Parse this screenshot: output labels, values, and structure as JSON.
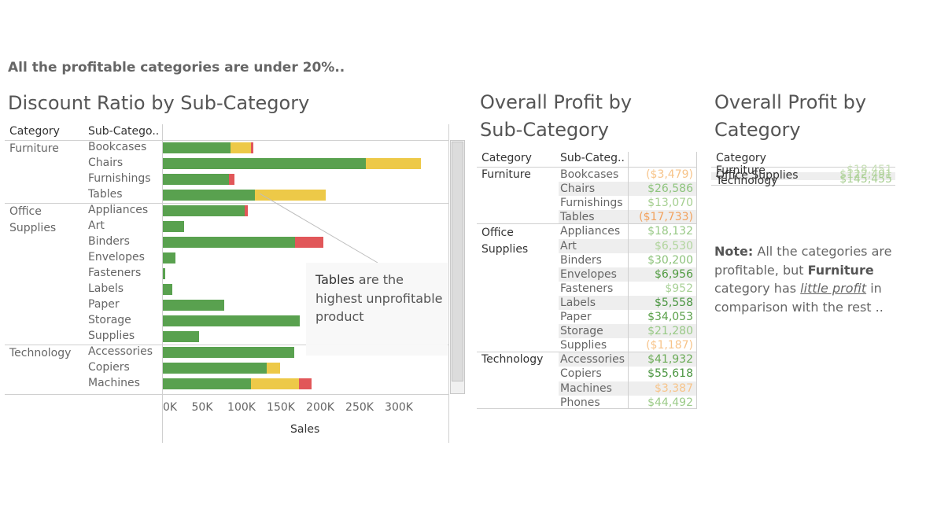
{
  "headline": "All the profitable categories are under 20%..",
  "discount_panel": {
    "title": "Discount Ratio by Sub-Category",
    "col_category": "Category",
    "col_subcategory": "Sub-Catego..",
    "xaxis_title": "Sales",
    "callout": {
      "bold": "Tables",
      "rest": " are the highest unprofitable product"
    }
  },
  "profit_sub_panel": {
    "title_line1": "Overall Profit by",
    "title_line2": "Sub-Category",
    "col_category": "Category",
    "col_subcategory": "Sub-Categ..",
    "categories": [
      "Furniture",
      "Office Supplies",
      "Technology"
    ],
    "rows": [
      {
        "sub": "Bookcases",
        "profit": "($3,479)",
        "color": "#f7c48a"
      },
      {
        "sub": "Chairs",
        "profit": "$26,586",
        "color": "#8fc47e"
      },
      {
        "sub": "Furnishings",
        "profit": "$13,070",
        "color": "#a5cf90"
      },
      {
        "sub": "Tables",
        "profit": "($17,733)",
        "color": "#f2a25e"
      },
      {
        "sub": "Appliances",
        "profit": "$18,132",
        "color": "#98c986"
      },
      {
        "sub": "Art",
        "profit": "$6,530",
        "color": "#b0d49c"
      },
      {
        "sub": "Binders",
        "profit": "$30,200",
        "color": "#8cc27a"
      },
      {
        "sub": "Envelopes",
        "profit": "$6,956",
        "color": "#4f9a3f"
      },
      {
        "sub": "Fasteners",
        "profit": "$952",
        "color": "#a9d197"
      },
      {
        "sub": "Labels",
        "profit": "$5,558",
        "color": "#4a9540"
      },
      {
        "sub": "Paper",
        "profit": "$34,053",
        "color": "#5aa049"
      },
      {
        "sub": "Storage",
        "profit": "$21,280",
        "color": "#98c986"
      },
      {
        "sub": "Supplies",
        "profit": "($1,187)",
        "color": "#f7c48a"
      },
      {
        "sub": "Accessories",
        "profit": "$41,932",
        "color": "#6aab56"
      },
      {
        "sub": "Copiers",
        "profit": "$55,618",
        "color": "#4a9540"
      },
      {
        "sub": "Machines",
        "profit": "$3,387",
        "color": "#f7c48a"
      },
      {
        "sub": "Phones",
        "profit": "$44,492",
        "color": "#9ccb89"
      }
    ]
  },
  "profit_cat_panel": {
    "title_line1": "Overall Profit by",
    "title_line2": "Category",
    "col_category": "Category",
    "overlap_labels": [
      "Furniture",
      "Office Supplies",
      "Technology"
    ],
    "overlap_values": [
      "$18,451",
      "$122,491",
      "$145,455"
    ]
  },
  "note": {
    "label": "Note:",
    "text1": " All the categories are profitable, but ",
    "bold": "Furniture",
    "text2": " category has ",
    "underlined": "little profit",
    "text3": " in comparison with the rest .."
  },
  "chart_data": {
    "type": "bar",
    "orientation": "horizontal",
    "stacked": true,
    "title": "Discount Ratio by Sub-Category",
    "xlabel": "Sales",
    "xlim": [
      0,
      345000
    ],
    "xticks": [
      0,
      50000,
      100000,
      150000,
      200000,
      250000,
      300000
    ],
    "xtick_labels": [
      "0K",
      "50K",
      "100K",
      "150K",
      "200K",
      "250K",
      "300K"
    ],
    "groups": [
      {
        "category": "Furniture",
        "rows": [
          "Bookcases",
          "Chairs",
          "Furnishings",
          "Tables"
        ]
      },
      {
        "category": "Office Supplies",
        "rows": [
          "Appliances",
          "Art",
          "Binders",
          "Envelopes",
          "Fasteners",
          "Labels",
          "Paper",
          "Storage",
          "Supplies"
        ]
      },
      {
        "category": "Technology",
        "rows": [
          "Accessories",
          "Copiers",
          "Machines"
        ]
      }
    ],
    "categories": [
      "Bookcases",
      "Chairs",
      "Furnishings",
      "Tables",
      "Appliances",
      "Art",
      "Binders",
      "Envelopes",
      "Fasteners",
      "Labels",
      "Paper",
      "Storage",
      "Supplies",
      "Accessories",
      "Copiers",
      "Machines"
    ],
    "series": [
      {
        "color": "#59a14f",
        "values": [
          86000,
          258000,
          84000,
          117000,
          104000,
          27000,
          168000,
          16000,
          3000,
          12000,
          78000,
          174000,
          46000,
          167000,
          132000,
          112000
        ]
      },
      {
        "color": "#edc948",
        "values": [
          26000,
          70000,
          0,
          90000,
          0,
          0,
          0,
          0,
          0,
          0,
          0,
          0,
          0,
          0,
          17000,
          61000
        ]
      },
      {
        "color": "#e15759",
        "values": [
          3000,
          0,
          7000,
          0,
          4000,
          0,
          36000,
          0,
          0,
          0,
          0,
          0,
          0,
          0,
          0,
          16000
        ]
      }
    ]
  }
}
